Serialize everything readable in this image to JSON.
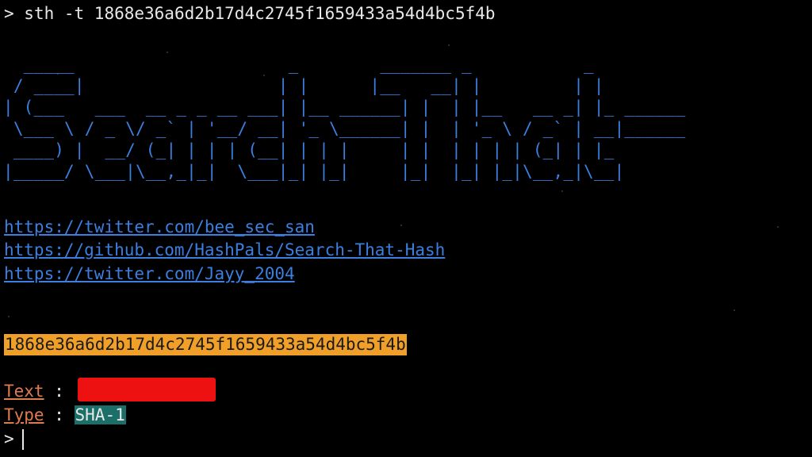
{
  "terminal": {
    "prompt_symbol": ">",
    "command": " sth -t 1868e36a6d2b17d4c2745f1659433a54d4bc5f4b",
    "banner_ascii": "  _____                     _        _______ _           _\n / ____|                   | |      |__   __| |         | |\n| (___   ___  __ _ _ __ ___| |__ ______| |  | |__   __ _| |_ ______\n \\___ \\ / _ \\/ _` | '__/ __| '_ \\______| |  | '_ \\ / _` | __|______\n ____) |  __/ (_| | | | (__| | | |     | |  | | | | (_| | |_\n|_____/ \\___|\\__,_|_|  \\___|_| |_|     |_|  |_| |_|\\__,_|\\__|",
    "links": [
      "https://twitter.com/bee_sec_san",
      "https://github.com/HashPals/Search-That-Hash",
      "https://twitter.com/Jayy_2004"
    ],
    "hash": "1868e36a6d2b17d4c2745f1659433a54d4bc5f4b",
    "result": {
      "text_label": "Text",
      "type_label": "Type",
      "separator": " : ",
      "type_value": "SHA-1"
    },
    "final_prompt": ">"
  },
  "colors": {
    "background": "#000000",
    "banner": "#3b7fe0",
    "link": "#3b7fe0",
    "hash_highlight": "#f0a028",
    "label": "#e07a50",
    "type_badge": "#1c6f68",
    "redaction": "#ee1111"
  }
}
